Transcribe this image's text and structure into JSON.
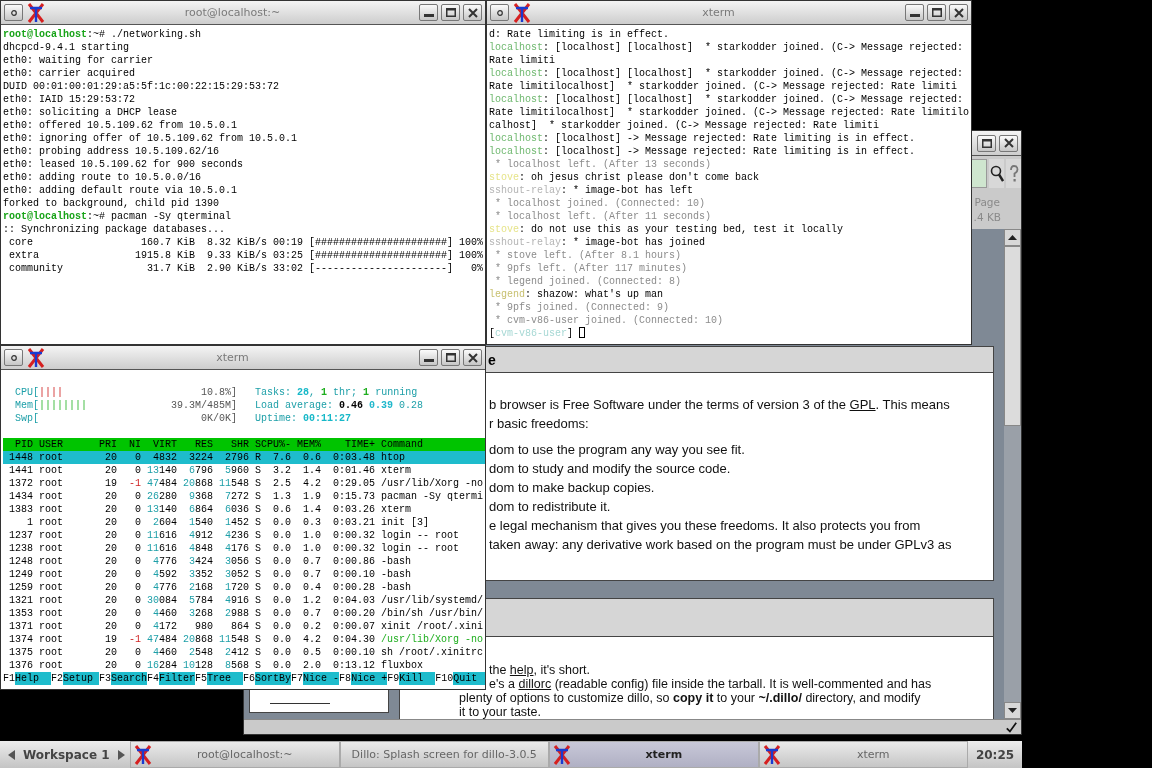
{
  "shell_window": {
    "title": "root@localhost:~",
    "lines": [
      [
        {
          "kind": "prompt",
          "text": "root@localhost"
        },
        {
          "kind": "text",
          "text": ":~# ./networking.sh"
        }
      ],
      [
        {
          "kind": "text",
          "text": "dhcpcd-9.4.1 starting"
        }
      ],
      [
        {
          "kind": "text",
          "text": "eth0: waiting for carrier"
        }
      ],
      [
        {
          "kind": "text",
          "text": "eth0: carrier acquired"
        }
      ],
      [
        {
          "kind": "text",
          "text": "DUID 00:01:00:01:29:a5:5f:1c:00:22:15:29:53:72"
        }
      ],
      [
        {
          "kind": "text",
          "text": "eth0: IAID 15:29:53:72"
        }
      ],
      [
        {
          "kind": "text",
          "text": "eth0: soliciting a DHCP lease"
        }
      ],
      [
        {
          "kind": "text",
          "text": "eth0: offered 10.5.109.62 from 10.5.0.1"
        }
      ],
      [
        {
          "kind": "text",
          "text": "eth0: ignoring offer of 10.5.109.62 from 10.5.0.1"
        }
      ],
      [
        {
          "kind": "text",
          "text": "eth0: probing address 10.5.109.62/16"
        }
      ],
      [
        {
          "kind": "text",
          "text": "eth0: leased 10.5.109.62 for 900 seconds"
        }
      ],
      [
        {
          "kind": "text",
          "text": "eth0: adding route to 10.5.0.0/16"
        }
      ],
      [
        {
          "kind": "text",
          "text": "eth0: adding default route via 10.5.0.1"
        }
      ],
      [
        {
          "kind": "text",
          "text": "forked to background, child pid 1390"
        }
      ],
      [
        {
          "kind": "prompt",
          "text": "root@localhost"
        },
        {
          "kind": "text",
          "text": ":~# pacman -Sy qterminal"
        }
      ],
      [
        {
          "kind": "text",
          "text": ":: Synchronizing package databases..."
        }
      ],
      [
        {
          "kind": "text",
          "text": " core                  160.7 KiB  8.32 KiB/s 00:19 [######################] 100%"
        }
      ],
      [
        {
          "kind": "text",
          "text": " extra                1915.8 KiB  9.33 KiB/s 03:25 [######################] 100%"
        }
      ],
      [
        {
          "kind": "text",
          "text": " community              31.7 KiB  2.90 KiB/s 33:02 [----------------------]   0%"
        }
      ]
    ]
  },
  "chat_window": {
    "title": "xterm",
    "lines": [
      [
        {
          "kind": "text",
          "text": "d: Rate limiting is in effect."
        }
      ],
      [
        {
          "kind": "nick",
          "color": "#6fb86f",
          "text": "localhost"
        },
        {
          "kind": "text",
          "text": ": [localhost] [localhost]  * starkodder joined. (C-> Message rejected:"
        }
      ],
      [
        {
          "kind": "text",
          "text": "Rate limiti"
        }
      ],
      [
        {
          "kind": "nick",
          "color": "#6fb86f",
          "text": "localhost"
        },
        {
          "kind": "text",
          "text": ": [localhost] [localhost]  * starkodder joined. (C-> Message rejected:"
        }
      ],
      [
        {
          "kind": "text",
          "text": "Rate limitilocalhost]  * starkodder joined. (C-> Message rejected: Rate limiti"
        }
      ],
      [
        {
          "kind": "nick",
          "color": "#6fb86f",
          "text": "localhost"
        },
        {
          "kind": "text",
          "text": ": [localhost] [localhost]  * starkodder joined. (C-> Message rejected:"
        }
      ],
      [
        {
          "kind": "text",
          "text": "Rate limitilocalhost]  * starkodder joined. (C-> Message rejected: Rate limitilo"
        }
      ],
      [
        {
          "kind": "text",
          "text": "calhost]  * starkodder joined. (C-> Message rejected: Rate limiti"
        }
      ],
      [
        {
          "kind": "nick",
          "color": "#6fb86f",
          "text": "localhost"
        },
        {
          "kind": "text",
          "text": ": [localhost] -> Message rejected: Rate limiting is in effect."
        }
      ],
      [
        {
          "kind": "nick",
          "color": "#6fb86f",
          "text": "localhost"
        },
        {
          "kind": "text",
          "text": ": [localhost] -> Message rejected: Rate limiting is in effect."
        }
      ],
      [
        {
          "kind": "system",
          "text": " * localhost left. (After 13 seconds)"
        }
      ],
      [
        {
          "kind": "nick",
          "color": "#e6e48a",
          "text": "stove"
        },
        {
          "kind": "text",
          "text": ": oh jesus christ please don't come back"
        }
      ],
      [
        {
          "kind": "nick",
          "color": "#b4b4b4",
          "text": "sshout-relay"
        },
        {
          "kind": "text",
          "text": ": * image-bot has left"
        }
      ],
      [
        {
          "kind": "system",
          "text": " * localhost joined. (Connected: 10)"
        }
      ],
      [
        {
          "kind": "system",
          "text": " * localhost left. (After 11 seconds)"
        }
      ],
      [
        {
          "kind": "nick",
          "color": "#e6e48a",
          "text": "stove"
        },
        {
          "kind": "text",
          "text": ": do not use this as your testing bed, test it locally"
        }
      ],
      [
        {
          "kind": "nick",
          "color": "#b4b4b4",
          "text": "sshout-relay"
        },
        {
          "kind": "text",
          "text": ": * image-bot has joined"
        }
      ],
      [
        {
          "kind": "system",
          "text": " * stove left. (After 8.1 hours)"
        }
      ],
      [
        {
          "kind": "system",
          "text": " * 9pfs left. (After 117 minutes)"
        }
      ],
      [
        {
          "kind": "system",
          "text": " * legend joined. (Connected: 8)"
        }
      ],
      [
        {
          "kind": "nick",
          "color": "#c8c070",
          "text": "legend"
        },
        {
          "kind": "text",
          "text": ": shazow: what's up man"
        }
      ],
      [
        {
          "kind": "system",
          "text": " * 9pfs joined. (Connected: 9)"
        }
      ],
      [
        {
          "kind": "system",
          "text": " * cvm-v86-user joined. (Connected: 10)"
        }
      ],
      [
        {
          "kind": "text",
          "text": "["
        },
        {
          "kind": "nick",
          "color": "#a6d8d4",
          "text": "cvm-v86-user"
        },
        {
          "kind": "text",
          "text": "] "
        },
        {
          "kind": "cursor"
        }
      ]
    ]
  },
  "htop_window": {
    "title": "xterm",
    "meters": [
      {
        "kind": "cpu",
        "label": "CPU[",
        "bars": "||||",
        "reading": "10.8%]"
      },
      {
        "kind": "mem",
        "label": "Mem[",
        "bars": "||||||||",
        "reading": "39.3M/485M]"
      },
      {
        "label": "Swp[",
        "reading": "0K/0K]"
      }
    ],
    "info": [
      [
        {
          "kind": "label",
          "text": "Tasks: "
        },
        {
          "kind": "value",
          "text": "28"
        },
        {
          "kind": "label",
          "text": ", "
        },
        {
          "kind": "running",
          "text": "1"
        },
        {
          "kind": "label",
          "text": " thr; "
        },
        {
          "kind": "running",
          "text": "1"
        },
        {
          "kind": "label",
          "text": " running"
        }
      ],
      [
        {
          "kind": "label",
          "text": "Load average: "
        },
        {
          "kind": "load1",
          "text": "0.46"
        },
        {
          "kind": "load5",
          "text": " 0.39"
        },
        {
          "kind": "label",
          "text": " 0.28"
        }
      ],
      [
        {
          "kind": "label",
          "text": "Uptime: "
        },
        {
          "kind": "value",
          "text": "00:11:27"
        }
      ]
    ],
    "columns": [
      "PID",
      "USER",
      "PRI",
      "NI",
      "VIRT",
      "RES",
      "SHR",
      "S",
      "CPU%-",
      "MEM%",
      "TIME+",
      "Command"
    ],
    "rows": [
      {
        "selected": true,
        "thread": false,
        "cells": [
          "1448",
          "root",
          "20",
          "0",
          "4832",
          "3224",
          "2796",
          "R",
          "7.6",
          "0.6",
          "0:03.48",
          "htop"
        ]
      },
      {
        "selected": false,
        "thread": false,
        "cells": [
          "1441",
          "root",
          "20",
          "0",
          "13140",
          "6796",
          "5960",
          "S",
          "3.2",
          "1.4",
          "0:01.46",
          "xterm"
        ]
      },
      {
        "selected": false,
        "thread": false,
        "cells": [
          "1372",
          "root",
          "19",
          "-1",
          "47484",
          "20868",
          "11548",
          "S",
          "2.5",
          "4.2",
          "0:29.05",
          "/usr/lib/Xorg -no"
        ]
      },
      {
        "selected": false,
        "thread": false,
        "cells": [
          "1434",
          "root",
          "20",
          "0",
          "26280",
          "9368",
          "7272",
          "S",
          "1.3",
          "1.9",
          "0:15.73",
          "pacman -Sy qtermi"
        ]
      },
      {
        "selected": false,
        "thread": false,
        "cells": [
          "1383",
          "root",
          "20",
          "0",
          "13140",
          "6864",
          "6036",
          "S",
          "0.6",
          "1.4",
          "0:03.26",
          "xterm"
        ]
      },
      {
        "selected": false,
        "thread": false,
        "cells": [
          "1",
          "root",
          "20",
          "0",
          "2604",
          "1540",
          "1452",
          "S",
          "0.0",
          "0.3",
          "0:03.21",
          "init [3]"
        ]
      },
      {
        "selected": false,
        "thread": false,
        "cells": [
          "1237",
          "root",
          "20",
          "0",
          "11616",
          "4912",
          "4236",
          "S",
          "0.0",
          "1.0",
          "0:00.32",
          "login -- root"
        ]
      },
      {
        "selected": false,
        "thread": false,
        "cells": [
          "1238",
          "root",
          "20",
          "0",
          "11616",
          "4848",
          "4176",
          "S",
          "0.0",
          "1.0",
          "0:00.32",
          "login -- root"
        ]
      },
      {
        "selected": false,
        "thread": false,
        "cells": [
          "1248",
          "root",
          "20",
          "0",
          "4776",
          "3424",
          "3056",
          "S",
          "0.0",
          "0.7",
          "0:00.86",
          "-bash"
        ]
      },
      {
        "selected": false,
        "thread": false,
        "cells": [
          "1249",
          "root",
          "20",
          "0",
          "4592",
          "3352",
          "3052",
          "S",
          "0.0",
          "0.7",
          "0:00.10",
          "-bash"
        ]
      },
      {
        "selected": false,
        "thread": false,
        "cells": [
          "1259",
          "root",
          "20",
          "0",
          "4776",
          "2168",
          "1720",
          "S",
          "0.0",
          "0.4",
          "0:00.28",
          "-bash"
        ]
      },
      {
        "selected": false,
        "thread": false,
        "cells": [
          "1321",
          "root",
          "20",
          "0",
          "30084",
          "5784",
          "4916",
          "S",
          "0.0",
          "1.2",
          "0:04.03",
          "/usr/lib/systemd/"
        ]
      },
      {
        "selected": false,
        "thread": false,
        "cells": [
          "1353",
          "root",
          "20",
          "0",
          "4460",
          "3268",
          "2988",
          "S",
          "0.0",
          "0.7",
          "0:00.20",
          "/bin/sh /usr/bin/"
        ]
      },
      {
        "selected": false,
        "thread": false,
        "cells": [
          "1371",
          "root",
          "20",
          "0",
          "4172",
          "980",
          "864",
          "S",
          "0.0",
          "0.2",
          "0:00.07",
          "xinit /root/.xini"
        ]
      },
      {
        "selected": false,
        "thread": true,
        "cells": [
          "1374",
          "root",
          "19",
          "-1",
          "47484",
          "20868",
          "11548",
          "S",
          "0.0",
          "4.2",
          "0:04.30",
          "/usr/lib/Xorg -no"
        ]
      },
      {
        "selected": false,
        "thread": false,
        "cells": [
          "1375",
          "root",
          "20",
          "0",
          "4460",
          "2548",
          "2412",
          "S",
          "0.0",
          "0.5",
          "0:00.10",
          "sh /root/.xinitrc"
        ]
      },
      {
        "selected": false,
        "thread": false,
        "cells": [
          "1376",
          "root",
          "20",
          "0",
          "16284",
          "10128",
          "8568",
          "S",
          "0.0",
          "2.0",
          "0:13.12",
          "fluxbox"
        ]
      }
    ],
    "function_keys": [
      {
        "key": "F1",
        "label": "Help"
      },
      {
        "key": "F2",
        "label": "Setup"
      },
      {
        "key": "F3",
        "label": "Search"
      },
      {
        "key": "F4",
        "label": "Filter"
      },
      {
        "key": "F5",
        "label": "Tree"
      },
      {
        "key": "F6",
        "label": "SortBy"
      },
      {
        "key": "F7",
        "label": "Nice -"
      },
      {
        "key": "F8",
        "label": "Nice +"
      },
      {
        "key": "F9",
        "label": "Kill"
      },
      {
        "key": "F10",
        "label": "Quit"
      }
    ]
  },
  "browser_window": {
    "page_label": "Page",
    "page_size": ".4 KB",
    "sections": [
      {
        "heading": "e",
        "paragraphs": [
          [
            {
              "kind": "cut",
              "segments": [
                {
                  "kind": "text",
                  "text": "b browser is Free Software under the terms of version 3 of the "
                },
                {
                  "kind": "link",
                  "text": "GPL"
                },
                {
                  "kind": "text",
                  "text": ". This means"
                }
              ]
            },
            {
              "kind": "cut",
              "segments": [
                {
                  "kind": "text",
                  "text": "r basic freedoms:"
                }
              ]
            }
          ],
          [
            {
              "kind": "cut",
              "segments": [
                {
                  "kind": "text",
                  "text": "dom to use the program any way you see fit."
                }
              ]
            },
            {
              "kind": "cut",
              "segments": [
                {
                  "kind": "text",
                  "text": "dom to study and modify the source code."
                }
              ]
            },
            {
              "kind": "cut",
              "segments": [
                {
                  "kind": "text",
                  "text": "dom to make backup copies."
                }
              ]
            },
            {
              "kind": "cut",
              "segments": [
                {
                  "kind": "text",
                  "text": "dom to redistribute it."
                }
              ]
            },
            {
              "kind": "cut",
              "segments": [
                {
                  "kind": "text",
                  "text": "e legal mechanism that gives you these freedoms. It also protects you from"
                }
              ]
            },
            {
              "kind": "cut",
              "segments": [
                {
                  "kind": "text",
                  "text": "taken away: any derivative work based on the program must be under GPLv3 as"
                }
              ]
            }
          ]
        ]
      },
      {
        "paragraphs": [
          [
            {
              "kind": "cut",
              "segments": [
                {
                  "kind": "text",
                  "text": "the "
                },
                {
                  "kind": "link",
                  "text": "help"
                },
                {
                  "kind": "text",
                  "text": ", it's short."
                }
              ]
            },
            {
              "kind": "cut",
              "segments": [
                {
                  "kind": "text",
                  "text": "e's a "
                },
                {
                  "kind": "link",
                  "text": "dillorc"
                },
                {
                  "kind": "text",
                  "text": " (readable config) file inside the tarball. It is well-commented and has"
                }
              ]
            },
            {
              "kind": "full",
              "segments": [
                {
                  "kind": "text",
                  "text": "plenty of options to customize dillo, so "
                },
                {
                  "kind": "bold",
                  "text": "copy it"
                },
                {
                  "kind": "text",
                  "text": " to your "
                },
                {
                  "kind": "bold",
                  "text": "~/.dillo/"
                },
                {
                  "kind": "text",
                  "text": " directory, and modify"
                }
              ]
            },
            {
              "kind": "full",
              "segments": [
                {
                  "kind": "text",
                  "text": "it to your taste."
                }
              ]
            }
          ]
        ]
      }
    ]
  },
  "taskbar": {
    "workspace": "Workspace 1",
    "tasks": [
      {
        "kind": "xterm",
        "title": "root@localhost:~",
        "selected": false
      },
      {
        "kind": "browser",
        "title": "Dillo: Splash screen for dillo-3.0.5",
        "selected": false
      },
      {
        "kind": "xterm",
        "title": "xterm",
        "selected": true
      },
      {
        "kind": "xterm",
        "title": "xterm",
        "selected": false
      }
    ],
    "clock": "20:25"
  }
}
